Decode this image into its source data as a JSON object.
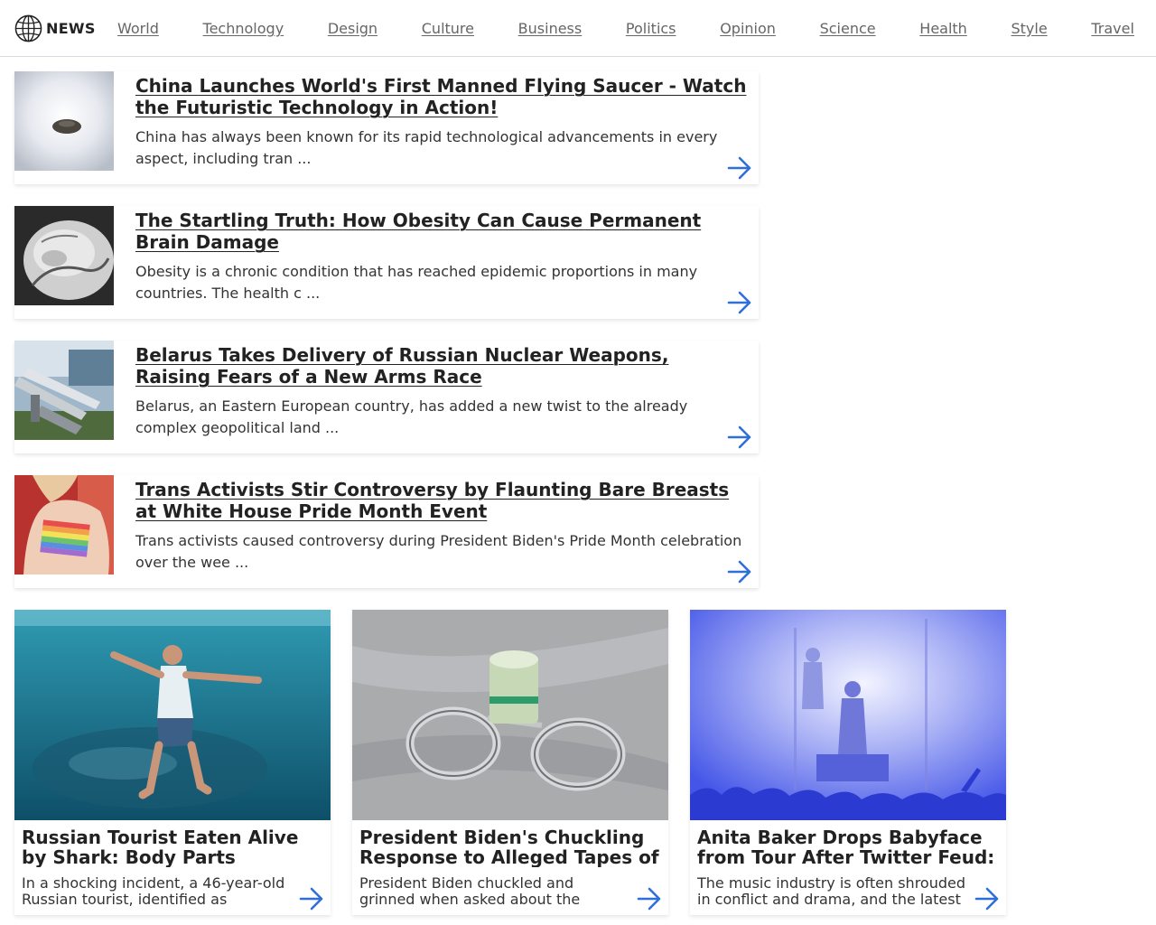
{
  "header": {
    "brand": "NEWS",
    "nav": [
      "World",
      "Technology",
      "Design",
      "Culture",
      "Business",
      "Politics",
      "Opinion",
      "Science",
      "Health",
      "Style",
      "Travel"
    ]
  },
  "list_articles": [
    {
      "title": "China Launches World's First Manned Flying Saucer - Watch the Futuristic Technology in Action!",
      "excerpt": "China has always been known for its rapid technological advancements in every aspect, including tran ...",
      "image": "flying-saucer-photo"
    },
    {
      "title": "The Startling Truth: How Obesity Can Cause Permanent Brain Damage",
      "excerpt": "Obesity is a chronic condition that has reached epidemic proportions in many countries. The health c ...",
      "image": "belly-measuring-tape-photo"
    },
    {
      "title": "Belarus Takes Delivery of Russian Nuclear Weapons, Raising Fears of a New Arms Race",
      "excerpt": "Belarus, an Eastern European country, has added a new twist to the already complex geopolitical land ...",
      "image": "missiles-photo"
    },
    {
      "title": "Trans Activists Stir Controversy by Flaunting Bare Breasts at White House Pride Month Event",
      "excerpt": "Trans activists caused controversy during President Biden's Pride Month celebration over the wee ...",
      "image": "rainbow-flag-back-photo"
    }
  ],
  "grid_articles": [
    {
      "title": "Russian Tourist Eaten Alive by Shark: Body Parts Recovered",
      "excerpt": "In a shocking incident, a 46-year-old Russian tourist, identified as",
      "image": "underwater-swimmer-photo"
    },
    {
      "title": "President Biden's Chuckling Response to Alleged Tapes of",
      "excerpt": "President Biden chuckled and grinned when asked about the alleged tapes",
      "image": "handcuffs-money-photo"
    },
    {
      "title": "Anita Baker Drops Babyface from Tour After Twitter Feud: What",
      "excerpt": "The music industry is often shrouded in conflict and drama, and the latest",
      "image": "concert-stage-photo"
    }
  ],
  "colors": {
    "accent": "#2f6fd8",
    "nav_text": "#666666",
    "divider": "#dddddd"
  }
}
